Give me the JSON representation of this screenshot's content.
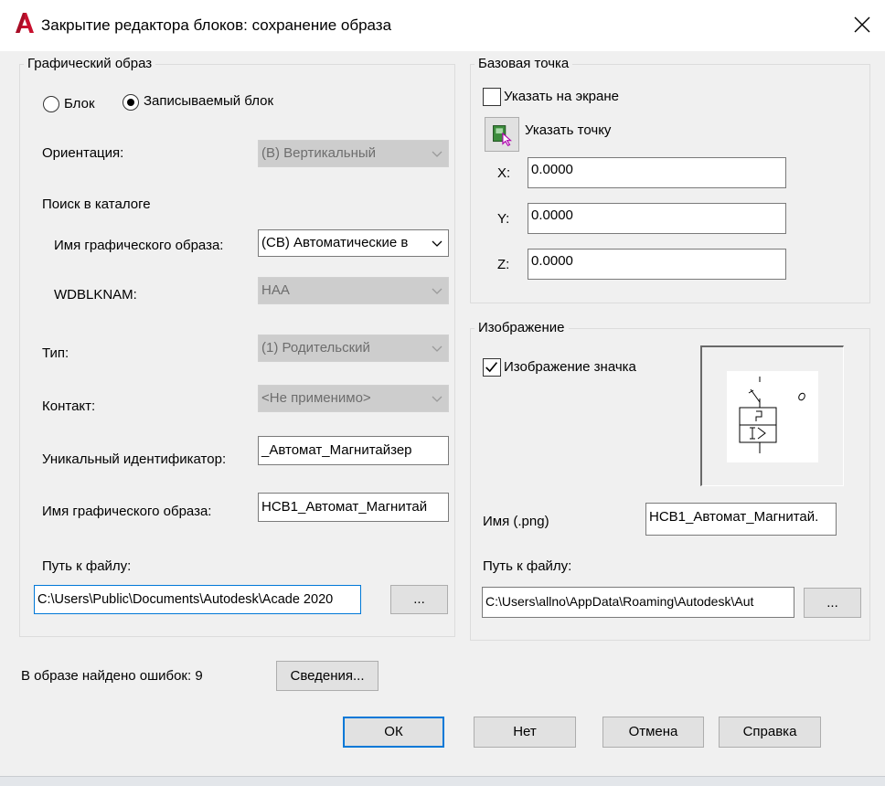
{
  "window": {
    "title": "Закрытие редактора блоков: сохранение образа",
    "app_icon": "autocad-a-icon",
    "close_icon": "close-icon"
  },
  "graphic": {
    "legend": "Графический образ",
    "radio_block": "Блок",
    "radio_wblock": "Записываемый блок",
    "orientation_label": "Ориентация:",
    "orientation_value": "(В) Вертикальный",
    "catalog_label": "Поиск в каталоге",
    "symname_label": "Имя графического образа:",
    "symname_value": "(СВ) Автоматические в",
    "wdblknam_label": "WDBLKNAM:",
    "wdblknam_value": "НАА",
    "type_label": "Тип:",
    "type_value": "(1) Родительский",
    "contact_label": "Контакт:",
    "contact_value": "<Не применимо>",
    "uid_label": "Уникальный идентификатор:",
    "uid_value": "_Автомат_Магнитайзер",
    "name_label": "Имя графического образа:",
    "name_value": "НСВ1_Автомат_Магнитай",
    "path_label": "Путь к файлу:",
    "path_value": "C:\\Users\\Public\\Documents\\Autodesk\\Acade 2020",
    "browse_label": "..."
  },
  "base": {
    "legend": "Базовая точка",
    "onscreen_label": "Указать на экране",
    "pick_label": "Указать точку",
    "pick_icon": "pick-point-icon",
    "x_label": "X:",
    "x_value": "0.0000",
    "y_label": "Y:",
    "y_value": "0.0000",
    "z_label": "Z:",
    "z_value": "0.0000"
  },
  "image": {
    "legend": "Изображение",
    "icon_label": "Изображение значка",
    "name_label": "Имя (.png)",
    "name_value": "НСВ1_Автомат_Магнитай.",
    "path_label": "Путь к файлу:",
    "path_value": "C:\\Users\\allno\\AppData\\Roaming\\Autodesk\\Aut",
    "browse_label": "..."
  },
  "footer": {
    "errors_text": "В образе найдено ошибок: 9",
    "details_label": "Сведения...",
    "ok_label": "ОК",
    "no_label": "Нет",
    "cancel_label": "Отмена",
    "help_label": "Справка"
  },
  "colors": {
    "accent": "#0078d7",
    "app_icon_red": "#c8102e",
    "disabled_fill": "#cdcdcd",
    "pick_icon_green": "#3c8c3c",
    "pick_icon_magenta": "#b000b0"
  }
}
